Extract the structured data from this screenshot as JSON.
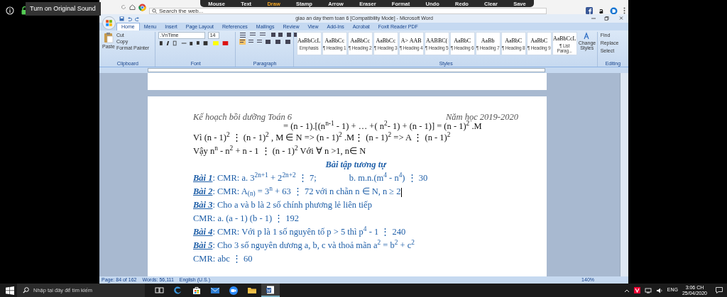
{
  "meeting": {
    "sound_button": "Turn on Original Sound"
  },
  "annotation_toolbar": [
    {
      "label": "Mouse",
      "selected": false
    },
    {
      "label": "Text",
      "selected": false
    },
    {
      "label": "Draw",
      "selected": true
    },
    {
      "label": "Stamp",
      "selected": false
    },
    {
      "label": "Arrow",
      "selected": false
    },
    {
      "label": "Eraser",
      "selected": false
    },
    {
      "label": "Format",
      "selected": false
    },
    {
      "label": "Undo",
      "selected": false
    },
    {
      "label": "Redo",
      "selected": false
    },
    {
      "label": "Clear",
      "selected": false
    },
    {
      "label": "Save",
      "selected": false
    }
  ],
  "browser": {
    "search_placeholder": "Search the web..."
  },
  "word": {
    "title": "giao an day them toan 6 [Compatibility Mode] - Microsoft Word",
    "tabs": [
      {
        "label": "Home",
        "selected": true
      },
      {
        "label": "Menu",
        "selected": false
      },
      {
        "label": "Insert",
        "selected": false
      },
      {
        "label": "Page Layout",
        "selected": false
      },
      {
        "label": "References",
        "selected": false
      },
      {
        "label": "Mailings",
        "selected": false
      },
      {
        "label": "Review",
        "selected": false
      },
      {
        "label": "View",
        "selected": false
      },
      {
        "label": "Add-Ins",
        "selected": false
      },
      {
        "label": "Acrobat",
        "selected": false
      },
      {
        "label": "Foxit Reader PDF",
        "selected": false
      }
    ],
    "clipboard": {
      "paste": "Paste",
      "items": [
        "Cut",
        "Copy",
        "Format Painter"
      ],
      "group": "Clipboard"
    },
    "font": {
      "name": ".VnTime",
      "size": "14",
      "group": "Font"
    },
    "paragraph": {
      "group": "Paragraph"
    },
    "styles": {
      "group": "Styles",
      "items": [
        {
          "preview": "AaBbCcL",
          "name": "Emphasis"
        },
        {
          "preview": "AaBbCc",
          "name": "¶ Heading 1"
        },
        {
          "preview": "AaBbCc",
          "name": "¶ Heading 2"
        },
        {
          "preview": "AaBbCc",
          "name": "¶ Heading 3"
        },
        {
          "preview": "A> AAB",
          "name": "¶ Heading 4"
        },
        {
          "preview": "AABBC(",
          "name": "¶ Heading 5"
        },
        {
          "preview": "AaBbC",
          "name": "¶ Heading 6"
        },
        {
          "preview": "AaBb",
          "name": "¶ Heading 7"
        },
        {
          "preview": "AaBbC",
          "name": "¶ Heading 8"
        },
        {
          "preview": "AaBbC",
          "name": "¶ Heading 9"
        },
        {
          "preview": "AaBbCcL",
          "name": "¶ List Parag..."
        }
      ],
      "change_styles": "Change Styles"
    },
    "editing": {
      "group": "Editing",
      "items": [
        "Find",
        "Replace",
        "Select"
      ]
    },
    "document": {
      "header_left": "Kế hoạch bồi dưỡng Toán 6",
      "header_right": "Năm học 2019-2020",
      "lines": [
        {
          "kind": "formula",
          "text": "= (n - 1).[(n$^{n-1}$ - 1) + … +( n$^{2}$- 1) + (n - 1)] = (n - 1)$^{2}$ .M"
        },
        {
          "kind": "text",
          "text": "Vì (n - 1)$^{2}$ ⋮ (n - 1)$^{2}$ , M ∈ N => (n - 1)$^{2}$ .M⋮ (n - 1)$^{2}$ => A ⋮ (n - 1)$^{2}$"
        },
        {
          "kind": "text",
          "text": "Vậy n$^{n}$ - n$^{2}$ + n - 1 ⋮ (n - 1)$^{2}$ Với ∀ n >1, n∈ N"
        },
        {
          "kind": "heading",
          "text": "Bài tập tương tự"
        },
        {
          "kind": "exercise",
          "text": "**Bài 1**: CMR: a. 3$^{2n+1}$ + 2$^{2n+2}$ ⋮ 7;",
          "extra": "b. m.n.(m$^{4}$ - n$^{4}$) ⋮ 30"
        },
        {
          "kind": "exercise",
          "text": "**Bài 2**: CMR: A$_{(n)}$ = 3$^{n}$ + 63 ⋮ 72 với n chẵn n ∈ N, n ≥ 2",
          "cursor": true
        },
        {
          "kind": "exercise",
          "text": "**Bài 3**: Cho a và b là 2 số chính phương lẻ liên tiếp"
        },
        {
          "kind": "exercise",
          "text": "CMR: a. (a - 1) (b - 1) ⋮ 192"
        },
        {
          "kind": "exercise",
          "text": "**Bài 4**: CMR: Với p là 1 số nguyên tố p > 5 thì p$^{4}$ - 1 ⋮ 240"
        },
        {
          "kind": "exercise",
          "text": "**Bài 5**: Cho 3 số nguyên dương a, b, c và thoả mãn a$^{2}$ = b$^{2}$ + c$^{2}$"
        },
        {
          "kind": "exercise",
          "text": "CMR: abc ⋮ 60"
        }
      ]
    },
    "status_bar": {
      "page": "Page: 84 of 162",
      "words": "Words: 56,111",
      "language": "English (U.S.)",
      "zoom": "140%"
    }
  },
  "taskbar": {
    "search_placeholder": "Nhập tại đây để tìm kiếm",
    "apps": [
      {
        "kind": "task-view",
        "selected": false
      },
      {
        "kind": "edge",
        "selected": false
      },
      {
        "kind": "store",
        "selected": false
      },
      {
        "kind": "mail",
        "selected": false
      },
      {
        "kind": "video",
        "selected": false
      },
      {
        "kind": "folder",
        "selected": false
      },
      {
        "kind": "word",
        "selected": true
      }
    ],
    "language": "ENG",
    "time": "3:06 CH",
    "date": "25/04/2020"
  }
}
